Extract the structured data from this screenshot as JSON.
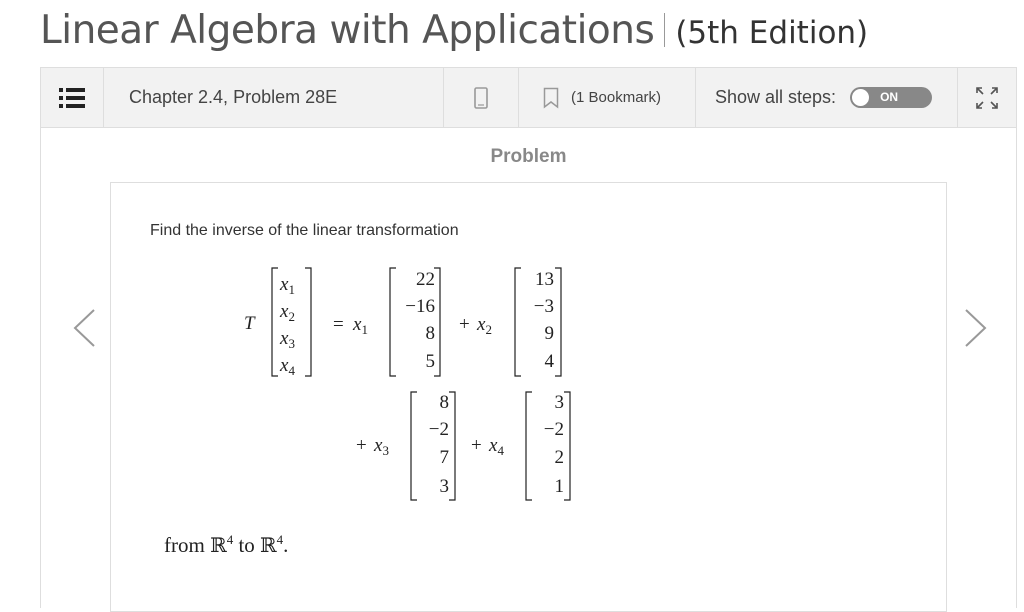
{
  "book": {
    "title": "Linear Algebra with Applications",
    "edition": "(5th Edition)"
  },
  "toolbar": {
    "chapter": "Chapter 2.4, Problem 28E",
    "bookmark": "(1 Bookmark)",
    "show_steps": "Show all steps:",
    "toggle_state": "ON"
  },
  "problem": {
    "heading": "Problem",
    "prompt": "Find the inverse of the linear transformation",
    "from_word": "from",
    "to_word": "to",
    "domain_symbol": "ℝ",
    "codomain_symbol": "ℝ",
    "domain_exp": "4",
    "codomain_exp": "4",
    "period": "."
  },
  "equation": {
    "lhs_symbol": "T",
    "input_vector": [
      "x1",
      "x2",
      "x3",
      "x4"
    ],
    "terms": [
      {
        "coef": "x1",
        "vector": [
          "22",
          "−16",
          "8",
          "5"
        ]
      },
      {
        "coef": "x2",
        "vector": [
          "13",
          "−3",
          "9",
          "4"
        ]
      },
      {
        "coef": "x3",
        "vector": [
          "8",
          "−2",
          "7",
          "3"
        ]
      },
      {
        "coef": "x4",
        "vector": [
          "3",
          "−2",
          "2",
          "1"
        ]
      }
    ]
  },
  "icons": {
    "menu": "list-icon",
    "mobile": "mobile-icon",
    "bookmark": "bookmark-icon",
    "expand": "expand-icon",
    "prev": "chevron-left-icon",
    "next": "chevron-right-icon"
  },
  "colors": {
    "toolbar_bg": "#f2f2f2",
    "toggle_bg": "#888888",
    "title": "#555555"
  }
}
